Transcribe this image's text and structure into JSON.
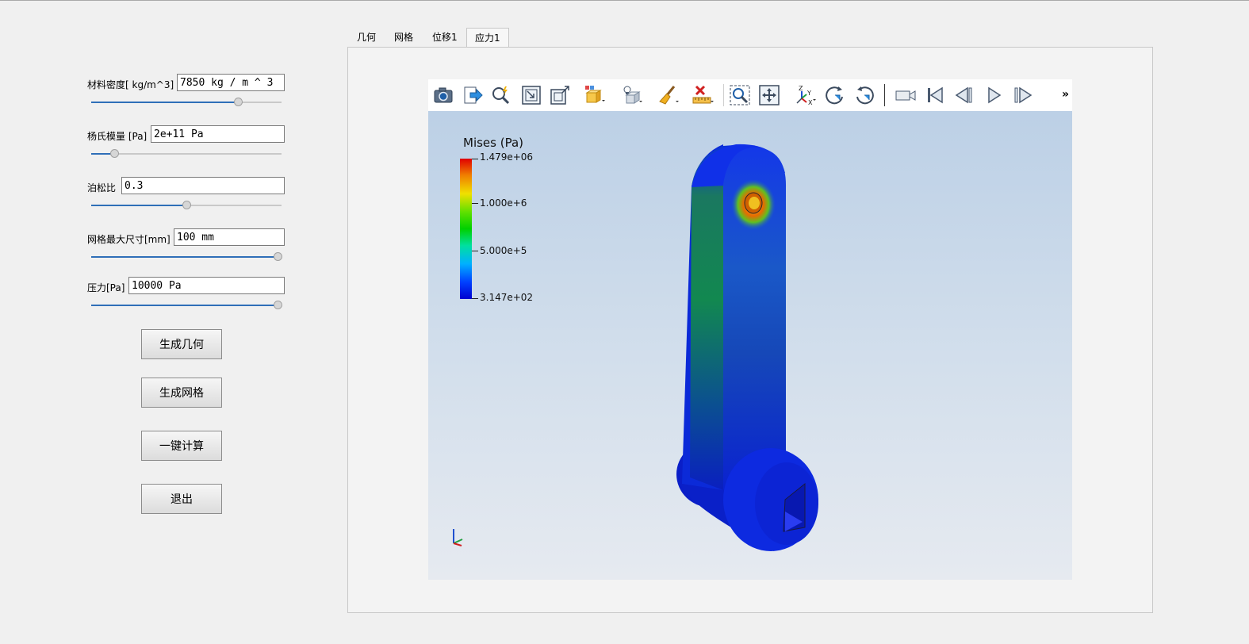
{
  "tabs": [
    {
      "label": "几何"
    },
    {
      "label": "网格"
    },
    {
      "label": "位移1"
    },
    {
      "label": "应力1"
    }
  ],
  "params": {
    "density": {
      "label": "材料密度[ kg/m^3]",
      "value": "7850 kg / m ^ 3",
      "slider": 0.77
    },
    "youngs": {
      "label": "杨氏模量 [Pa]",
      "value": "2e+11 Pa",
      "slider": 0.12
    },
    "poisson": {
      "label": "泊松比",
      "value": "0.3",
      "slider": 0.5
    },
    "mesh": {
      "label": "网格最大尺寸[mm]",
      "value": "100 mm",
      "slider": 0.98
    },
    "pressure": {
      "label": "压力[Pa]",
      "value": "10000 Pa",
      "slider": 0.98
    }
  },
  "buttons": {
    "gen_geometry": "生成几何",
    "gen_mesh": "生成网格",
    "compute": "一键计算",
    "exit": "退出"
  },
  "toolbar": {
    "icons": [
      "camera-icon",
      "export-icon",
      "interactive-select-icon",
      "reset-zoom-icon",
      "zoom-fit-icon",
      "display-style-icon",
      "light-bulb-icon",
      "clear-brush-icon",
      "ruler-delete-icon",
      "zoom-box-icon",
      "pan-icon",
      "axes-icon",
      "rotate-cw-icon",
      "rotate-ccw-icon",
      "camera-record-icon",
      "first-frame-icon",
      "prev-frame-icon",
      "play-icon",
      "next-frame-icon"
    ],
    "more": "»"
  },
  "legend": {
    "title": "Mises (Pa)",
    "ticks": [
      "1.479e+06",
      "1.000e+6",
      "5.000e+5",
      "3.147e+02"
    ]
  },
  "colors": {
    "slider_fill": "#2f6fb8",
    "part_blue": "#0a2fd8",
    "hot_spot": "#e84000"
  }
}
